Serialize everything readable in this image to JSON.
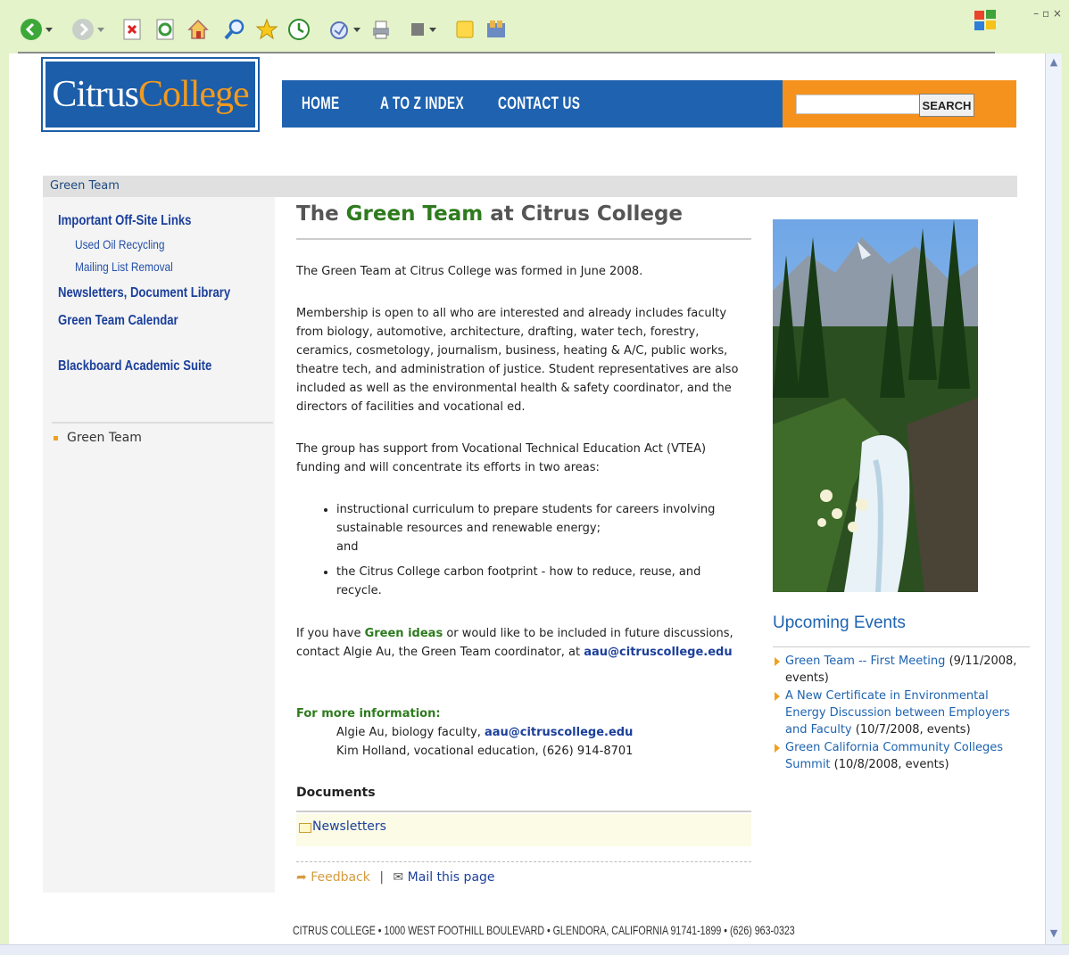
{
  "browser": {
    "toolbar_icons": [
      "back-icon",
      "forward-icon",
      "stop-icon",
      "refresh-icon",
      "home-icon",
      "search-icon",
      "favorites-icon",
      "history-icon",
      "mail-icon",
      "print-icon",
      "edit-icon",
      "notes-icon",
      "messenger-icon"
    ],
    "window_controls": "– ▫ ×"
  },
  "header": {
    "logo_word1": "Citrus",
    "logo_word2": "College",
    "nav": [
      "HOME",
      "A TO Z INDEX",
      "CONTACT US"
    ],
    "search_button": "SEARCH",
    "search_value": ""
  },
  "breadcrumb": "Green Team",
  "sidebar": {
    "links": {
      "offsite": "Important Off-Site Links",
      "used_oil": "Used Oil Recycling",
      "mailing": "Mailing List Removal",
      "newsletters": "Newsletters, Document Library",
      "calendar": "Green Team Calendar",
      "blackboard": "Blackboard Academic Suite"
    },
    "current": "Green Team"
  },
  "main": {
    "title_pre": "The ",
    "title_green": "Green Team",
    "title_post": " at Citrus College",
    "p1": "The Green Team at Citrus College was formed in June 2008.",
    "p2": "Membership is open to all who are interested and already includes faculty from biology, automotive, architecture, drafting, water tech, forestry, ceramics, cosmetology, journalism, business, heating & A/C, public works, theatre tech, and administration of justice. Student representatives are also included as well as the environmental health & safety coordinator, and the directors of facilities and vocational ed.",
    "p3": "The group has support from Vocational Technical Education Act (VTEA) funding and will concentrate its efforts in two areas:",
    "bullet1": "instructional curriculum to prepare students for careers involving sustainable resources and renewable energy;",
    "bullet1_and": "and",
    "bullet2": "the Citrus College carbon footprint - how to reduce, reuse, and recycle.",
    "p4_pre": "If you have ",
    "p4_green": "Green ideas",
    "p4_mid": " or would like to be included in future discussions, contact Algie Au, the Green Team coordinator, at ",
    "p4_email": "aau@citruscollege.edu",
    "more_info_label": "For more information:",
    "contact1_pre": "Algie Au, biology faculty, ",
    "contact1_email": "aau@citruscollege.edu",
    "contact2": "Kim Holland, vocational education, (626) 914-8701",
    "documents_title": "Documents",
    "documents_item": "Newsletters",
    "feedback": "Feedback",
    "separator": "|",
    "mail_page": "Mail this page"
  },
  "events": {
    "title": "Upcoming Events",
    "items": [
      {
        "name": "Green Team -- First Meeting",
        "meta": "(9/11/2008, events)"
      },
      {
        "name": "A New Certificate in Environmental Energy Discussion between Employers and Faculty",
        "meta": "(10/7/2008, events)"
      },
      {
        "name": "Green California Community Colleges Summit",
        "meta": "(10/8/2008, events)"
      }
    ]
  },
  "footer": "CITRUS COLLEGE  •  1000 WEST FOOTHILL BOULEVARD  •  GLENDORA, CALIFORNIA 91741-1899  •  (626) 963-0323",
  "colors": {
    "nav_blue": "#1f63b0",
    "nav_orange": "#f5921e",
    "green_accent": "#2e7b1e",
    "link_blue": "#1b3f9b",
    "frame_green": "#e4f3c9"
  }
}
